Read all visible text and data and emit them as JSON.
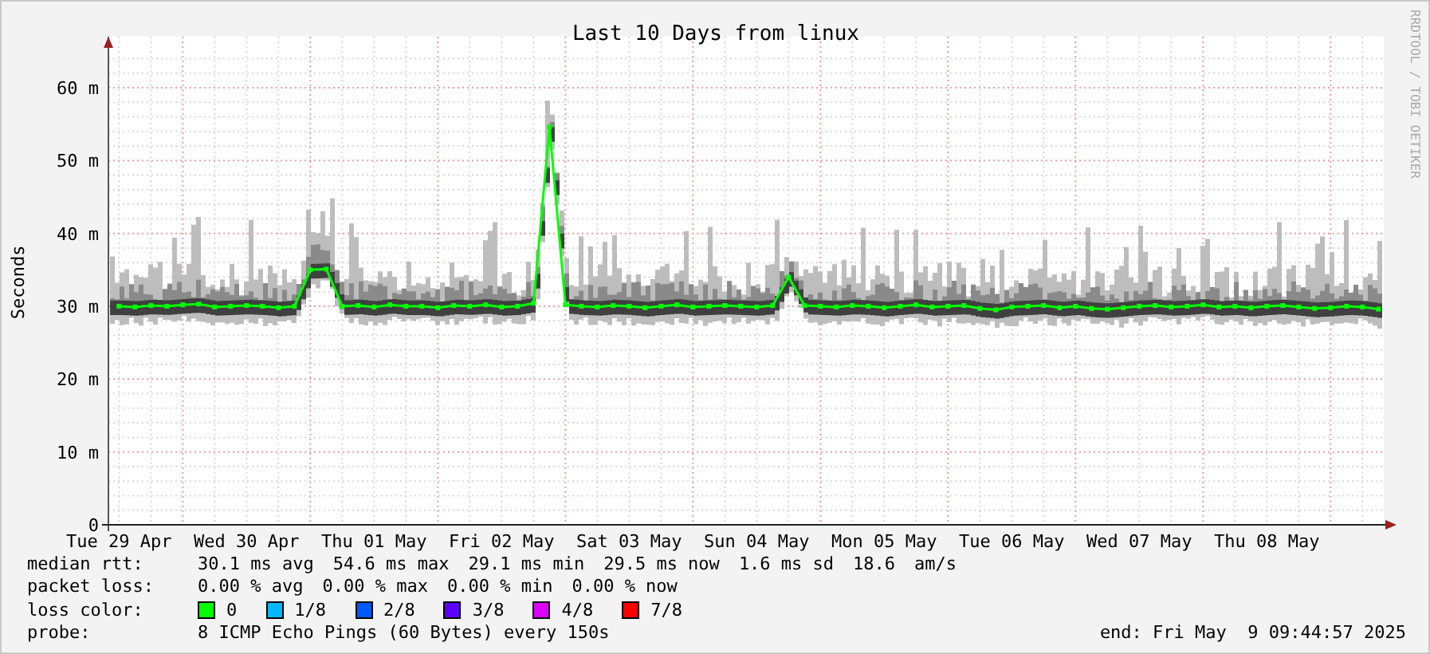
{
  "graph": {
    "credit": "RRDTOOL / TOBI OETIKER",
    "chart_data": {
      "type": "line",
      "title": "Last 10 Days from linux",
      "ylabel": "Seconds",
      "categories": [
        "Tue 29 Apr",
        null,
        null,
        null,
        null,
        null,
        null,
        null,
        "Wed 30 Apr",
        null,
        null,
        null,
        null,
        null,
        null,
        null,
        "Thu 01 May",
        null,
        null,
        null,
        null,
        null,
        null,
        null,
        "Fri 02 May",
        null,
        null,
        null,
        null,
        null,
        null,
        null,
        "Sat 03 May",
        null,
        null,
        null,
        null,
        null,
        null,
        null,
        "Sun 04 May",
        null,
        null,
        null,
        null,
        null,
        null,
        null,
        "Mon 05 May",
        null,
        null,
        null,
        null,
        null,
        null,
        null,
        "Tue 06 May",
        null,
        null,
        null,
        null,
        null,
        null,
        null,
        "Wed 07 May",
        null,
        null,
        null,
        null,
        null,
        null,
        null,
        "Thu 08 May",
        null,
        null,
        null,
        null,
        null,
        null,
        null
      ],
      "series": [
        {
          "name": "median rtt:",
          "color": "#00ff00",
          "marker": "square",
          "values": [
            30,
            29.9,
            30.1,
            30,
            30.2,
            30.3,
            29.9,
            30,
            30.1,
            30,
            29.8,
            30,
            35,
            35.1,
            30,
            30.1,
            29.9,
            30.2,
            30,
            30,
            29.8,
            30.1,
            30,
            30.2,
            29.9,
            30,
            30.4,
            54.6,
            30.2,
            30,
            29.9,
            30.1,
            30,
            29.8,
            30,
            30.2,
            29.9,
            30,
            30.1,
            30,
            29.9,
            30.1,
            34,
            30.1,
            30,
            29.9,
            30.1,
            30,
            29.8,
            30,
            30.2,
            29.9,
            30,
            30.1,
            29.7,
            29.5,
            29.9,
            30,
            30.1,
            29.8,
            30,
            29.7,
            29.6,
            29.8,
            30,
            30.1,
            29.9,
            30,
            30.2,
            29.9,
            30,
            29.8,
            30,
            30.1,
            29.9,
            29.7,
            29.8,
            30,
            29.9,
            29.6
          ]
        }
      ],
      "ylim": [
        0,
        67
      ],
      "grid": true,
      "yticks": [
        {
          "value": 0,
          "label": "0"
        },
        {
          "value": 10,
          "label": "10 m"
        },
        {
          "value": 20,
          "label": "20 m"
        },
        {
          "value": 30,
          "label": "30 m"
        },
        {
          "value": 40,
          "label": "40 m"
        },
        {
          "value": 50,
          "label": "50 m"
        },
        {
          "value": 60,
          "label": "60 m"
        }
      ]
    }
  },
  "legend": {
    "median_rtt": {
      "values": [
        "30.1 ms avg",
        "54.6 ms max",
        "29.1 ms min",
        "29.5 ms now",
        "1.6 ms sd",
        "18.6",
        "am/s"
      ]
    },
    "packet_loss": {
      "label": "packet loss:",
      "values": [
        "0.00 % avg",
        "0.00 % max",
        "0.00 % min",
        "0.00 % now"
      ]
    },
    "loss_color": {
      "label": "loss color:",
      "items": [
        {
          "label": "0",
          "color": "#00ff00"
        },
        {
          "label": "1/8",
          "color": "#00b8ff"
        },
        {
          "label": "2/8",
          "color": "#0059ff"
        },
        {
          "label": "3/8",
          "color": "#5e00ff"
        },
        {
          "label": "4/8",
          "color": "#dd00ff"
        },
        {
          "label": "7/8",
          "color": "#ff0000"
        }
      ]
    },
    "probe": {
      "label": "probe:",
      "value": "8 ICMP Echo Pings (60 Bytes) every 150s"
    },
    "end": "end: Fri May  9 09:44:57 2025"
  }
}
